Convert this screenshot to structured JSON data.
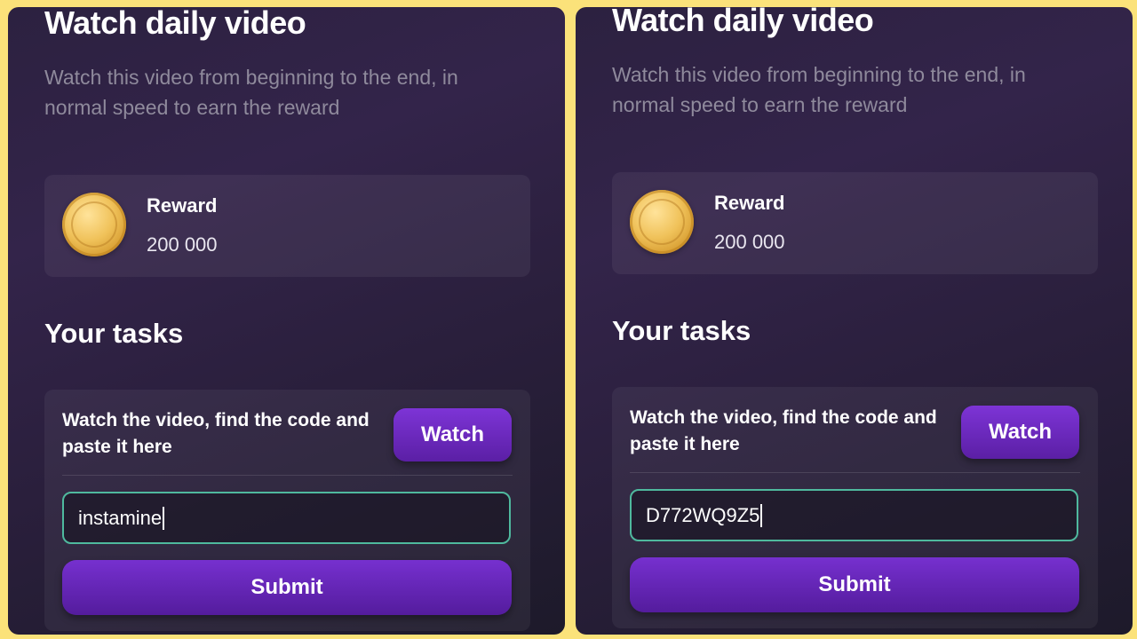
{
  "colors": {
    "background_border": "#fbe27a",
    "accent_purple": "#6a28bd",
    "input_border": "#4fb99e",
    "coin_gold": "#f0c25a"
  },
  "panels": [
    {
      "title": "Watch daily video",
      "description": "Watch this video from beginning to the end, in normal speed to earn the reward",
      "reward": {
        "icon": "gold-coin-icon",
        "label": "Reward",
        "amount": "200 000"
      },
      "tasks_title": "Your tasks",
      "task": {
        "text": "Watch the video, find the code and paste it here",
        "watch_label": "Watch",
        "input_value": "instamine",
        "submit_label": "Submit"
      }
    },
    {
      "title": "Watch daily video",
      "description": "Watch this video from beginning to the end, in normal speed to earn the reward",
      "reward": {
        "icon": "gold-coin-icon",
        "label": "Reward",
        "amount": "200 000"
      },
      "tasks_title": "Your tasks",
      "task": {
        "text": "Watch the video, find the code and paste it here",
        "watch_label": "Watch",
        "input_value": "D772WQ9Z5",
        "submit_label": "Submit"
      }
    }
  ]
}
